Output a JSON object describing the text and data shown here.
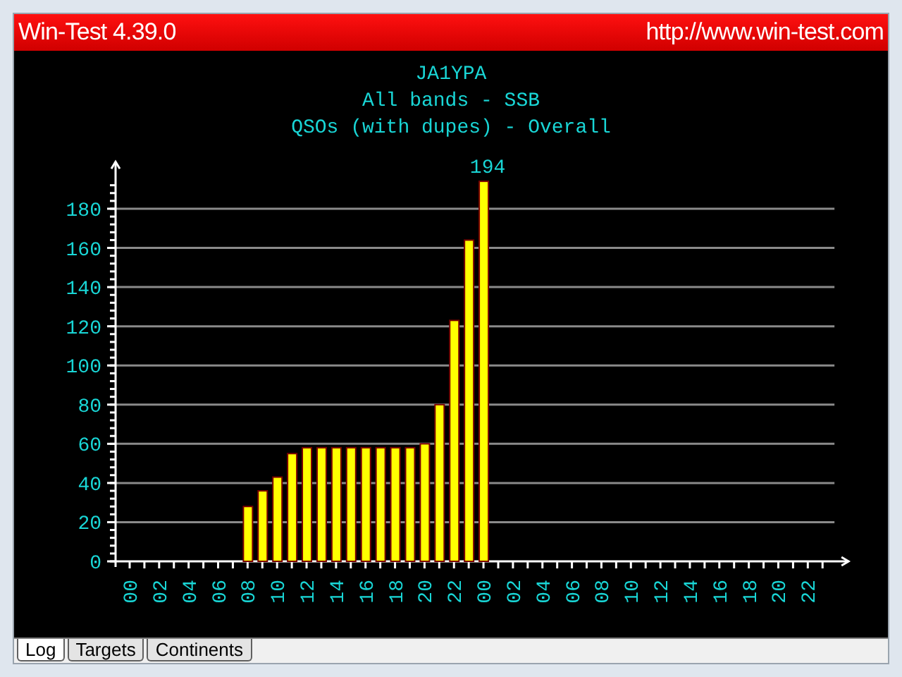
{
  "window": {
    "title": "Win-Test 4.39.0",
    "url": "http://www.win-test.com"
  },
  "chart": {
    "title_lines": [
      "JA1YPA",
      "All bands - SSB",
      "QSOs (with dupes) - Overall"
    ],
    "chart_data": {
      "type": "bar",
      "ylim": [
        0,
        204
      ],
      "yticks": [
        0,
        20,
        40,
        60,
        80,
        100,
        120,
        140,
        160,
        180
      ],
      "grid": true,
      "categories": [
        "00",
        null,
        "02",
        null,
        "04",
        null,
        "06",
        null,
        "08",
        null,
        "10",
        null,
        "12",
        null,
        "14",
        null,
        "16",
        null,
        "18",
        null,
        "20",
        null,
        "22",
        null,
        "00",
        null,
        "02",
        null,
        "04",
        null,
        "06",
        null,
        "08",
        null,
        "10",
        null,
        "12",
        null,
        "14",
        null,
        "16",
        null,
        "18",
        null,
        "20",
        null,
        "22",
        null
      ],
      "series": [
        {
          "color": "#ffff00",
          "values": [
            null,
            null,
            null,
            null,
            null,
            null,
            null,
            null,
            28,
            36,
            43,
            55,
            58,
            58,
            58,
            58,
            58,
            58,
            58,
            58,
            60,
            80,
            123,
            164,
            194,
            null,
            null,
            null,
            null,
            null,
            null,
            null,
            null,
            null,
            null,
            null,
            null,
            null,
            null,
            null,
            null,
            null,
            null,
            null,
            null,
            null,
            null,
            null
          ]
        }
      ],
      "annotations": [
        "194"
      ]
    }
  },
  "tabs": [
    {
      "label": "Log",
      "selected": true
    },
    {
      "label": "Targets",
      "selected": false
    },
    {
      "label": "Continents",
      "selected": false
    }
  ]
}
